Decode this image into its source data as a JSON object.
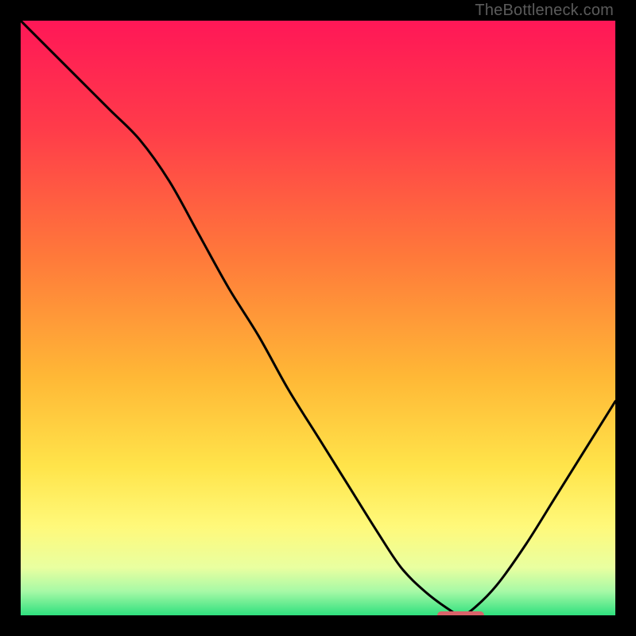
{
  "watermark": "TheBottleneck.com",
  "chart_data": {
    "type": "line",
    "title": "",
    "xlabel": "",
    "ylabel": "",
    "xlim": [
      0,
      100
    ],
    "ylim": [
      0,
      100
    ],
    "grid": false,
    "legend": false,
    "series": [
      {
        "name": "bottleneck-curve",
        "x": [
          0,
          5,
          10,
          15,
          20,
          25,
          30,
          35,
          40,
          45,
          50,
          55,
          60,
          64,
          68,
          72,
          74,
          76,
          80,
          85,
          90,
          95,
          100
        ],
        "values": [
          100,
          95,
          90,
          85,
          80,
          73,
          64,
          55,
          47,
          38,
          30,
          22,
          14,
          8,
          4,
          1,
          0,
          1,
          5,
          12,
          20,
          28,
          36
        ]
      }
    ],
    "optimal_marker": {
      "x_start": 70,
      "x_end": 78,
      "y": 0
    },
    "gradient_stops": [
      {
        "pct": 0,
        "color": "#ff1757"
      },
      {
        "pct": 18,
        "color": "#ff3b4a"
      },
      {
        "pct": 40,
        "color": "#ff7a3a"
      },
      {
        "pct": 60,
        "color": "#ffb836"
      },
      {
        "pct": 75,
        "color": "#ffe44a"
      },
      {
        "pct": 85,
        "color": "#fff97a"
      },
      {
        "pct": 92,
        "color": "#e9ffa0"
      },
      {
        "pct": 96,
        "color": "#a6f9a6"
      },
      {
        "pct": 100,
        "color": "#2fe07e"
      }
    ]
  }
}
